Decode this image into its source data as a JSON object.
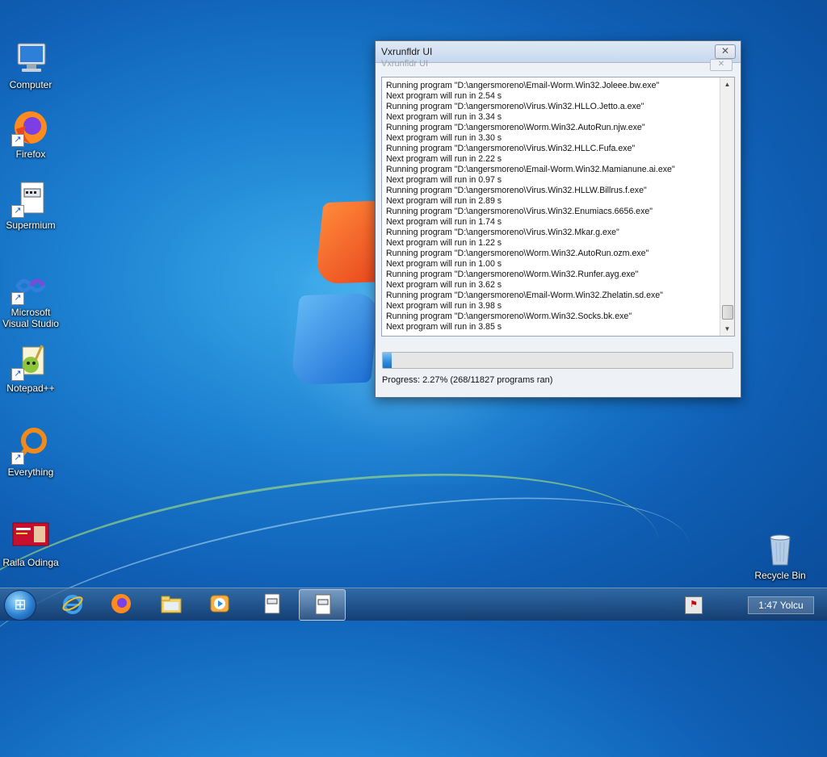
{
  "desktop": {
    "icons": [
      {
        "label": "Computer"
      },
      {
        "label": "Firefox"
      },
      {
        "label": "Supermium"
      },
      {
        "label": "Microsoft Visual Studio"
      },
      {
        "label": "Notepad++"
      },
      {
        "label": "Everything"
      },
      {
        "label": "Raila Odinga"
      },
      {
        "label": "Recycle Bin"
      }
    ]
  },
  "window": {
    "title": "Vxrunfldr UI",
    "ghost_title": "Vxrunfldr UI",
    "close_symbol": "✕",
    "log_lines": [
      "Running program \"D:\\angersmoreno\\Email-Worm.Win32.Joleee.bw.exe\"",
      "Next program will run in 2.54 s",
      "Running program \"D:\\angersmoreno\\Virus.Win32.HLLO.Jetto.a.exe\"",
      "Next program will run in 3.34 s",
      "Running program \"D:\\angersmoreno\\Worm.Win32.AutoRun.njw.exe\"",
      "Next program will run in 3.30 s",
      "Running program \"D:\\angersmoreno\\Virus.Win32.HLLC.Fufa.exe\"",
      "Next program will run in 2.22 s",
      "Running program \"D:\\angersmoreno\\Email-Worm.Win32.Mamianune.ai.exe\"",
      "Next program will run in 0.97 s",
      "Running program \"D:\\angersmoreno\\Virus.Win32.HLLW.Billrus.f.exe\"",
      "Next program will run in 2.89 s",
      "Running program \"D:\\angersmoreno\\Virus.Win32.Enumiacs.6656.exe\"",
      "Next program will run in 1.74 s",
      "Running program \"D:\\angersmoreno\\Virus.Win32.Mkar.g.exe\"",
      "Next program will run in 1.22 s",
      "Running program \"D:\\angersmoreno\\Worm.Win32.AutoRun.ozm.exe\"",
      "Next program will run in 1.00 s",
      "Running program \"D:\\angersmoreno\\Worm.Win32.Runfer.ayg.exe\"",
      "Next program will run in 3.62 s",
      "Running program \"D:\\angersmoreno\\Email-Worm.Win32.Zhelatin.sd.exe\"",
      "Next program will run in 3.98 s",
      "Running program \"D:\\angersmoreno\\Worm.Win32.Socks.bk.exe\"",
      "Next program will run in 3.85 s"
    ],
    "progress_fraction": 0.0227,
    "progress_text": "Progress: 2.27% (268/11827 programs ran)"
  },
  "taskbar": {
    "pinned": [
      {
        "icon": "internet-explorer-icon"
      },
      {
        "icon": "firefox-icon"
      },
      {
        "icon": "file-explorer-icon"
      },
      {
        "icon": "media-player-icon"
      },
      {
        "icon": "app-window-icon"
      },
      {
        "icon": "app-window-icon-active"
      }
    ],
    "clock": "1:47 Yolcu"
  },
  "colors": {
    "accent": "#2f8ad9",
    "desktop_blue": "#1c7fd0"
  }
}
